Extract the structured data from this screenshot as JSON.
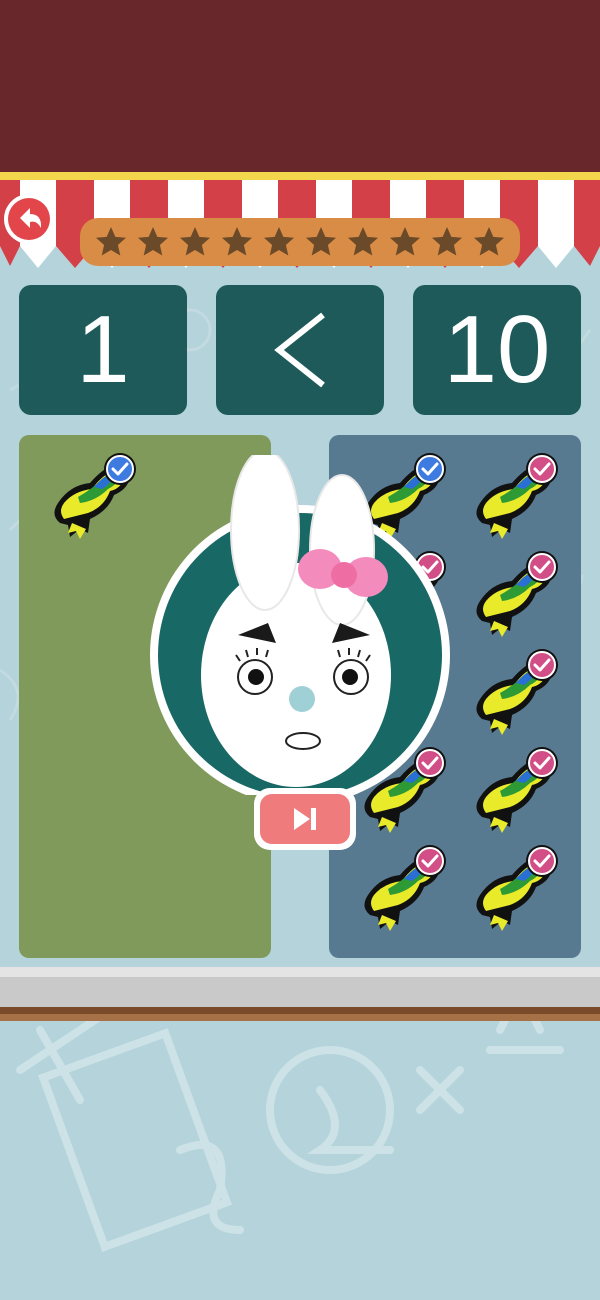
{
  "comparison": {
    "left_number": "1",
    "sign": "<",
    "right_number": "10"
  },
  "stars": {
    "total": 10,
    "filled": 0
  },
  "left_group": {
    "count": 1,
    "check": "blue"
  },
  "right_group": {
    "count": 10,
    "checks_blue": 1,
    "checks_pink": 9
  },
  "icons": {
    "back": "back-arrow-icon",
    "skip": "skip-next-icon",
    "star": "star-icon",
    "item": "bird-icon"
  },
  "colors": {
    "header": "#68282b",
    "number_box": "#1f5a5a",
    "left_panel": "#7f9a5a",
    "right_panel": "#587a91",
    "star": "#6b4a2a",
    "star_bar": "#d98c45",
    "check_blue": "#3d7be0",
    "check_pink": "#d24e86"
  }
}
